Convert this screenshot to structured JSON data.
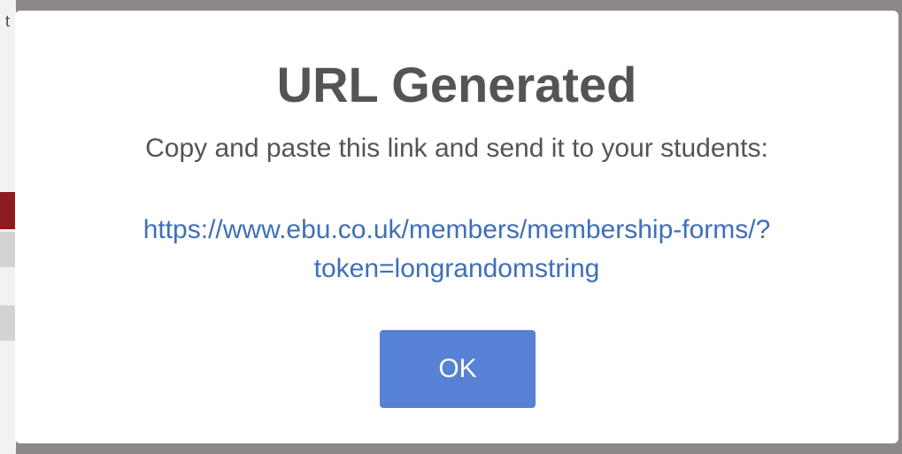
{
  "background": {
    "partial_char": "t"
  },
  "dialog": {
    "title": "URL Generated",
    "message": "Copy and paste this link and send it to your students:",
    "link_line1": "https://www.ebu.co.uk/members/membership-forms/?",
    "link_line2": "token=longrandomstring",
    "ok_label": "OK"
  },
  "colors": {
    "overlay": "#8c8888",
    "dialog_bg": "#ffffff",
    "title_text": "#545454",
    "link": "#3f6fb8",
    "button_bg": "#5681d4",
    "button_text": "#ffffff",
    "bg_accent_red": "#8e1b1f"
  }
}
